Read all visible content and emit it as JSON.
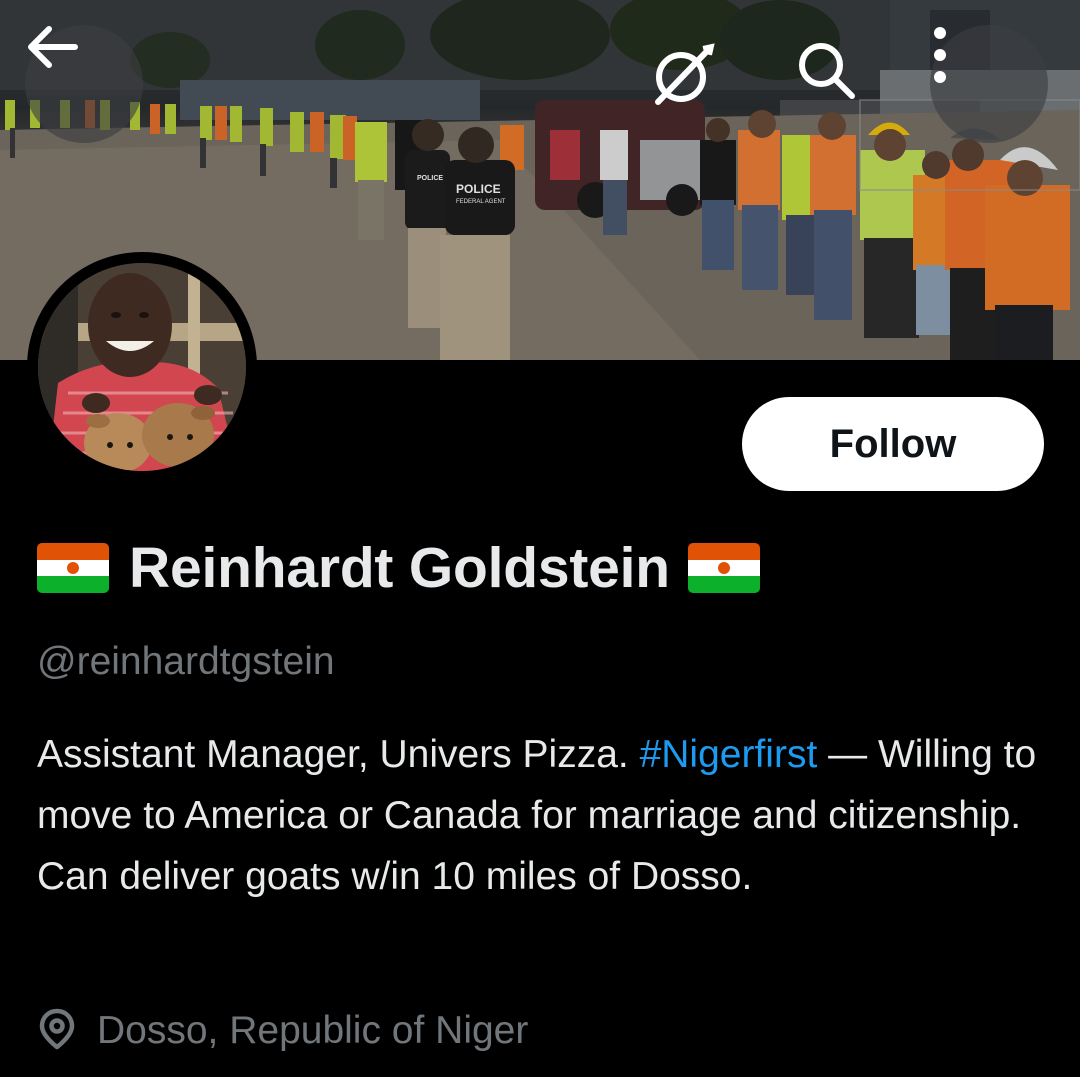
{
  "header": {
    "back_icon": "arrow-left-icon",
    "grok_icon": "grok-icon",
    "search_icon": "search-icon",
    "more_icon": "more-vertical-icon"
  },
  "banner": {
    "vest_text_1": "POLICE",
    "vest_text_2": "FEDERAL AGENT",
    "small_vest_text": "POLICE"
  },
  "profile": {
    "display_name": "Reinhardt Goldstein",
    "flag_icon": "niger-flag-icon",
    "handle": "@reinhardtgstein",
    "follow_label": "Follow",
    "bio_part1": "Assistant Manager, Univers Pizza. ",
    "bio_hashtag": "#Nigerfirst",
    "bio_part2": " — Willing to move to America or Canada for marriage and citizenship. Can deliver goats w/in 10 miles of Dosso.",
    "location_icon": "location-pin-icon",
    "location": "Dosso, Republic of Niger"
  },
  "colors": {
    "background": "#000000",
    "primary_text": "#e7e9ea",
    "secondary_text": "#71767b",
    "link": "#1d9bf0",
    "follow_bg": "#ffffff",
    "niger_orange": "#e05206",
    "niger_green": "#0db02b"
  }
}
